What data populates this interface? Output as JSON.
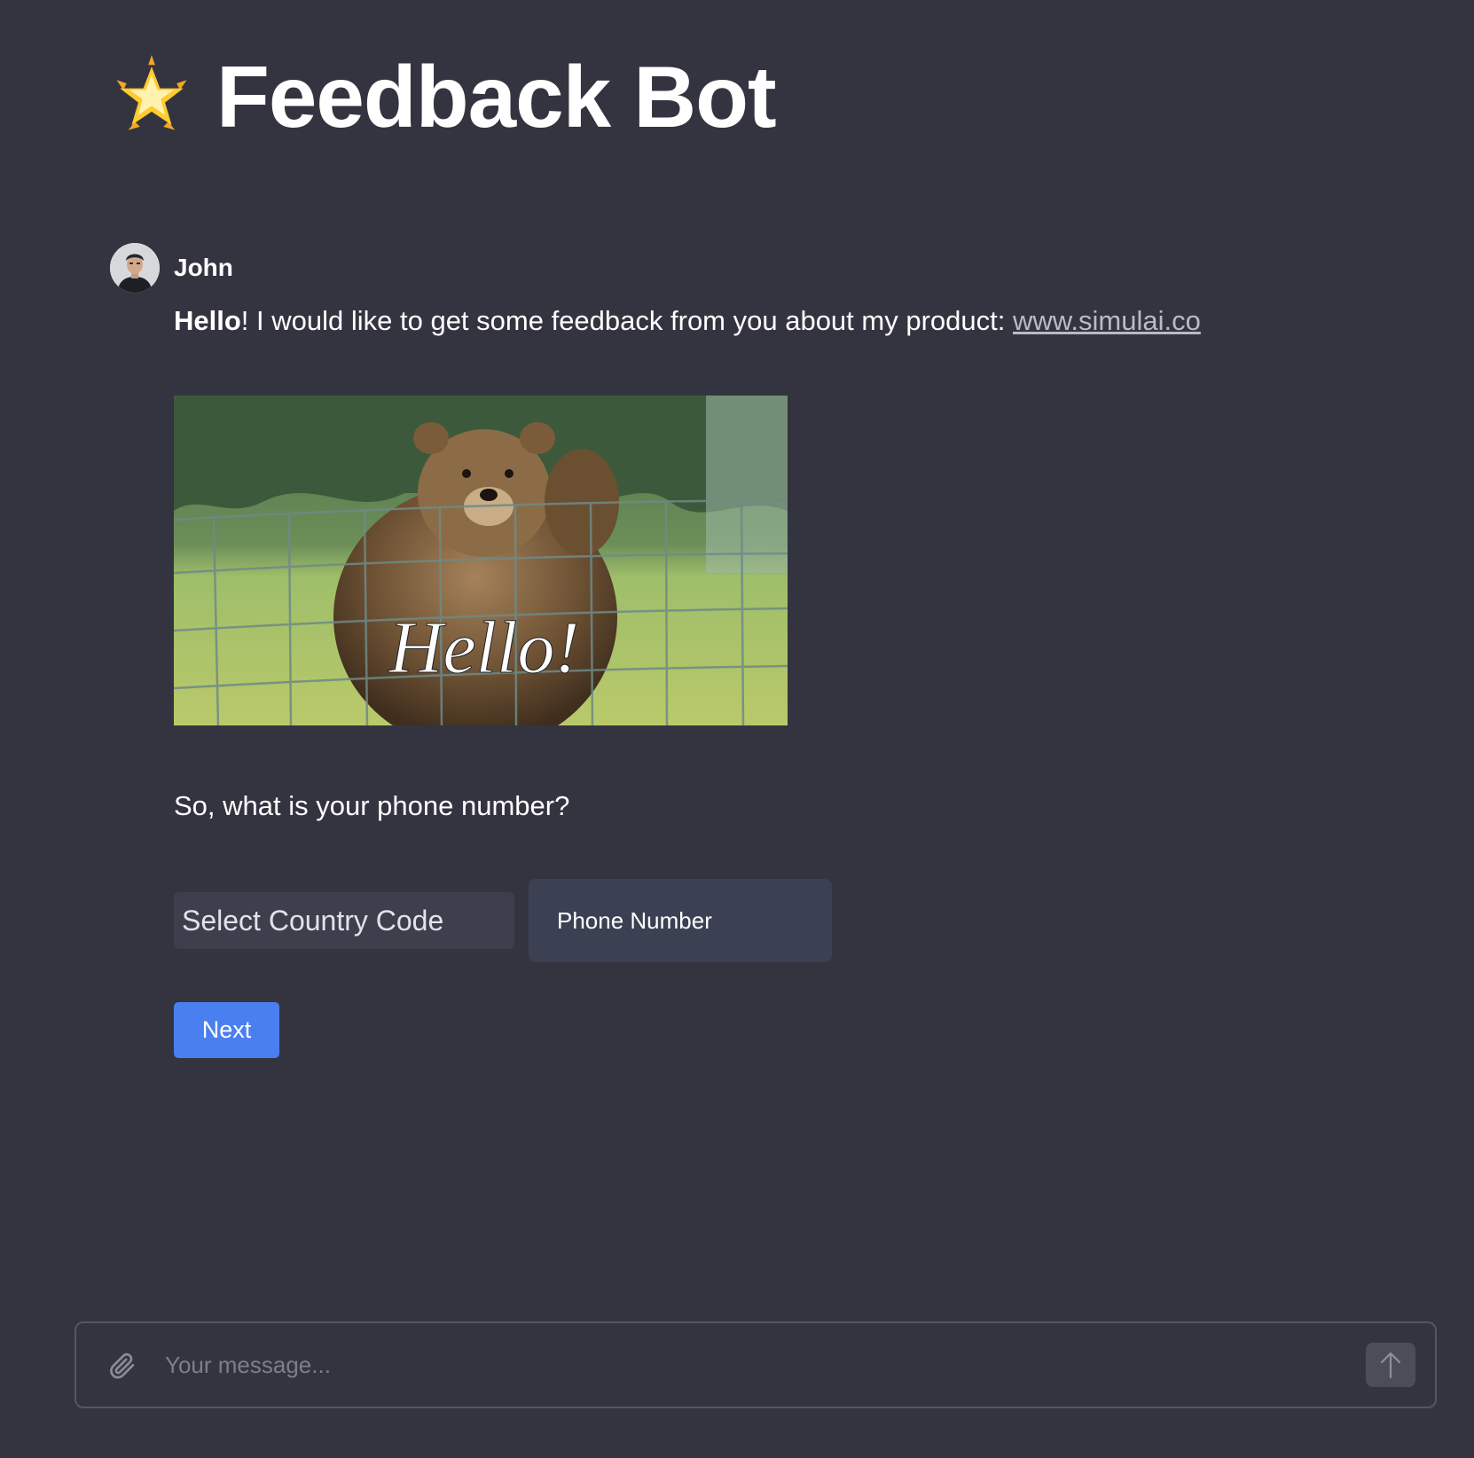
{
  "header": {
    "icon": "glowing-star-icon",
    "title": "Feedback Bot"
  },
  "message": {
    "author": "John",
    "greeting_bold": "Hello",
    "greeting_rest": "! I would like to get some feedback from you about my product: ",
    "link_text": "www.simulai.co",
    "gif_caption": "Hello!",
    "question": "So, what is your phone number?"
  },
  "form": {
    "country_code_placeholder": "Select Country Code",
    "phone_placeholder": "Phone Number",
    "next_label": "Next"
  },
  "composer": {
    "placeholder": "Your message...",
    "attach_icon": "paperclip-icon",
    "send_icon": "arrow-up-icon"
  },
  "colors": {
    "background": "#343441",
    "accent": "#4a7ff0",
    "input_bg": "#3b4152"
  }
}
